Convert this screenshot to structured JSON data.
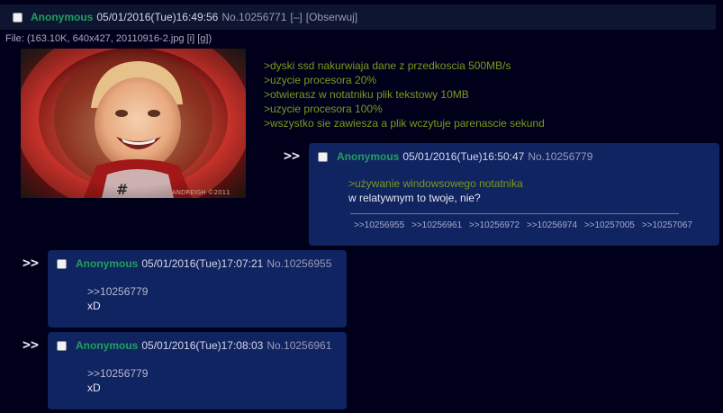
{
  "op": {
    "name": "Anonymous",
    "date": "05/01/2016(Tue)16:49:56",
    "number": "No.10256771",
    "hide_label": "[–]",
    "follow_label": "[Obserwuj]",
    "file": {
      "prefix": "File: (163.10K, 640x427, 20110916-2.jpg",
      "link_i": "[i]",
      "link_g": "[g]",
      "close": ")"
    },
    "watermark": "ANDREIGH ©2011",
    "lines": [
      ">dyski ssd nakurwiaja dane z przedkoscia 500MB/s",
      ">uzycie procesora 20%",
      ">otwierasz w notatniku plik tekstowy 10MB",
      ">uzycie procesora 100%",
      ">wszystko sie zawiesza a plik wczytuje parenascie sekund"
    ]
  },
  "replies": [
    {
      "arrows": ">>",
      "name": "Anonymous",
      "date": "05/01/2016(Tue)16:50:47",
      "number": "No.10256779",
      "greentext": ">używanie windowsowego notatnika",
      "text": "w relatywnym to twoje, nie?",
      "backlinks": [
        ">>10256955",
        ">>10256961",
        ">>10256972",
        ">>10256974",
        ">>10257005",
        ">>10257067"
      ]
    },
    {
      "arrows": ">>",
      "name": "Anonymous",
      "date": "05/01/2016(Tue)17:07:21",
      "number": "No.10256955",
      "quote": ">>10256779",
      "text": "xD"
    },
    {
      "arrows": ">>",
      "name": "Anonymous",
      "date": "05/01/2016(Tue)17:08:03",
      "number": "No.10256961",
      "quote": ">>10256779",
      "text": "xD"
    }
  ]
}
